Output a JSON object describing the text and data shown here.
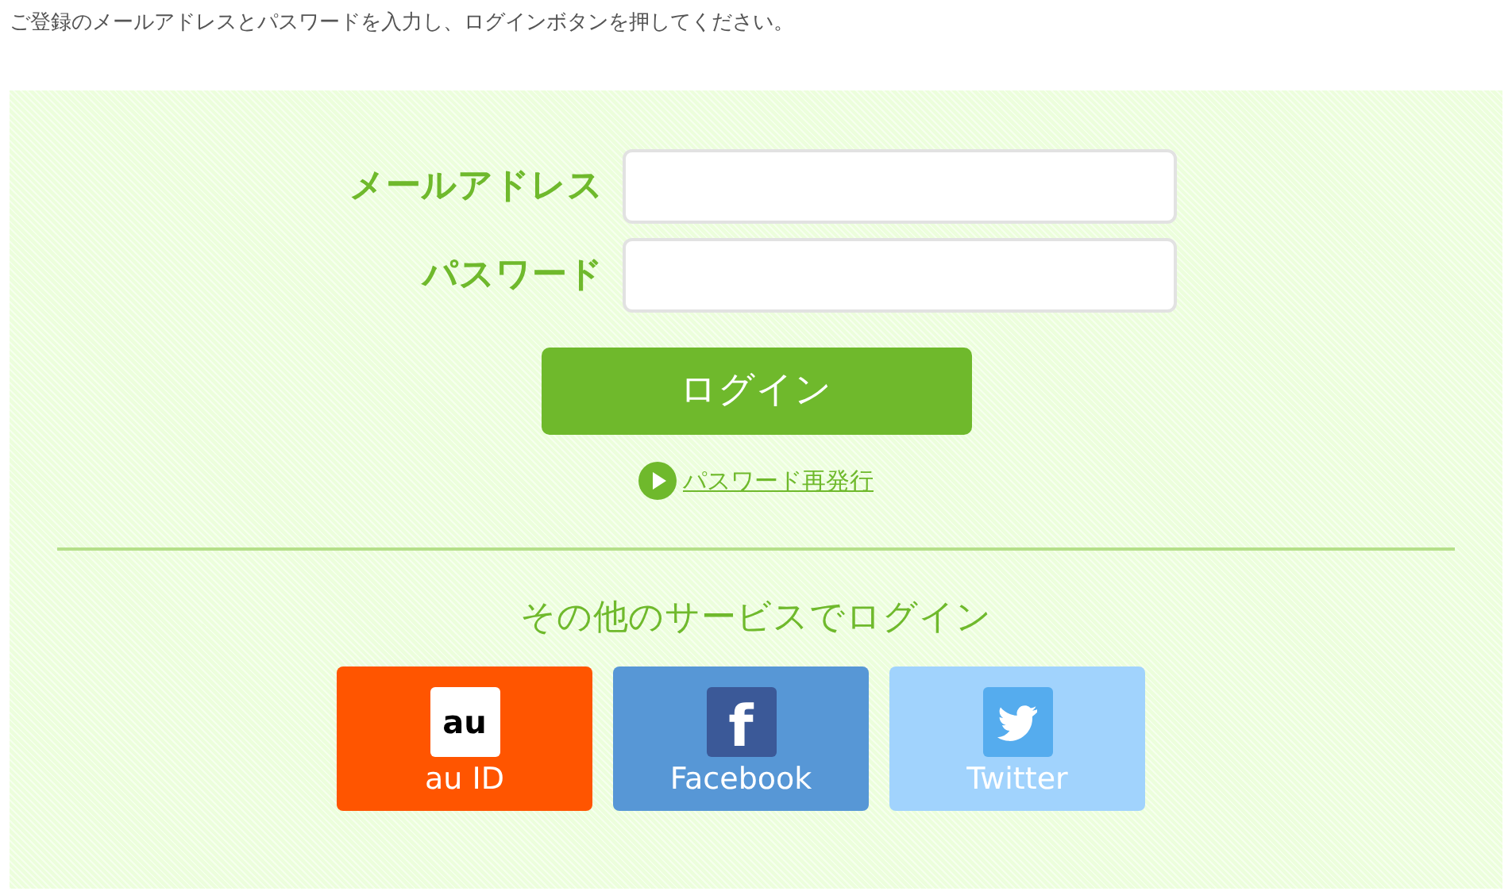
{
  "intro": "ご登録のメールアドレスとパスワードを入力し、ログインボタンを押してください。",
  "fields": [
    {
      "label": "メールアドレス"
    },
    {
      "label": "パスワード"
    }
  ],
  "login_button": "ログイン",
  "reset_link": "パスワード再発行",
  "other_heading": "その他のサービスでログイン",
  "services": [
    {
      "kind": "au",
      "logo": "au",
      "label": "au ID",
      "color": "#ff5500"
    },
    {
      "kind": "facebook",
      "logo": "f",
      "label": "Facebook",
      "color": "#5797d6"
    },
    {
      "kind": "twitter",
      "label": "Twitter",
      "color": "#a1d3fd"
    }
  ]
}
